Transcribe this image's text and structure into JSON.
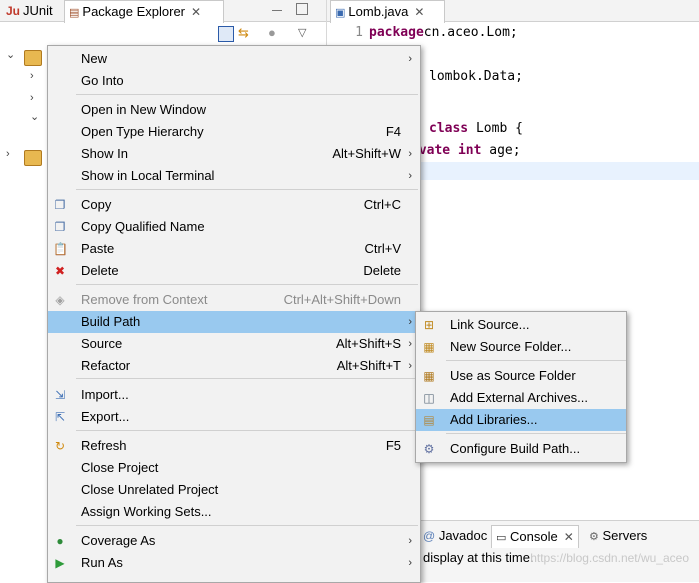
{
  "package_explorer": {
    "tab_junit": "JUnit",
    "tab_label": "Package Explorer"
  },
  "editor": {
    "tab_label": "Lomb.java",
    "lines": [
      {
        "num": "1",
        "parts": [
          [
            "kw",
            "package"
          ],
          [
            "",
            "cn.aceo.Lom;"
          ]
        ]
      },
      {
        "num": "",
        "parts": [
          [
            "",
            ""
          ]
        ]
      },
      {
        "num": "",
        "parts": [
          [
            "",
            "lombok.Data;"
          ]
        ]
      },
      {
        "num": "",
        "parts": [
          [
            "",
            ""
          ]
        ]
      },
      {
        "num": "",
        "parts": [
          [
            "kw",
            "class"
          ],
          [
            "",
            " Lomb {"
          ]
        ]
      },
      {
        "num": "",
        "parts": [
          [
            "kw",
            "ivate"
          ],
          [
            "",
            " "
          ],
          [
            "kw",
            "int"
          ],
          [
            "",
            " age;"
          ]
        ]
      }
    ]
  },
  "bottom_panel": {
    "tab_javadoc": "Javadoc",
    "tab_console": "Console",
    "tab_servers": "Servers",
    "console_text": "display at this time.",
    "watermark": "https://blog.csdn.net/wu_aceo"
  },
  "context_menu": {
    "items": [
      {
        "key": "new",
        "label": "New",
        "accel": "",
        "submenu": true,
        "icon": ""
      },
      {
        "key": "go-into",
        "label": "Go Into",
        "accel": "",
        "submenu": false,
        "icon": ""
      },
      {
        "key": "open-in-new-window",
        "label": "Open in New Window",
        "accel": "",
        "submenu": false,
        "icon": ""
      },
      {
        "key": "open-type-hierarchy",
        "label": "Open Type Hierarchy",
        "accel": "F4",
        "submenu": false,
        "icon": ""
      },
      {
        "key": "show-in",
        "label": "Show In",
        "accel": "Alt+Shift+W",
        "submenu": true,
        "icon": ""
      },
      {
        "key": "show-in-local-terminal",
        "label": "Show in Local Terminal",
        "accel": "",
        "submenu": true,
        "icon": ""
      },
      {
        "key": "copy",
        "label": "Copy",
        "accel": "Ctrl+C",
        "submenu": false,
        "icon": "copy-icon"
      },
      {
        "key": "copy-qualified-name",
        "label": "Copy Qualified Name",
        "accel": "",
        "submenu": false,
        "icon": "copy-icon"
      },
      {
        "key": "paste",
        "label": "Paste",
        "accel": "Ctrl+V",
        "submenu": false,
        "icon": "paste-icon"
      },
      {
        "key": "delete",
        "label": "Delete",
        "accel": "Delete",
        "submenu": false,
        "icon": "delete-icon"
      },
      {
        "key": "remove-from-context",
        "label": "Remove from Context",
        "accel": "Ctrl+Alt+Shift+Down",
        "submenu": false,
        "icon": "remove-context-icon",
        "disabled": true
      },
      {
        "key": "build-path",
        "label": "Build Path",
        "accel": "",
        "submenu": true,
        "icon": "",
        "highlighted": true
      },
      {
        "key": "source",
        "label": "Source",
        "accel": "Alt+Shift+S",
        "submenu": true,
        "icon": ""
      },
      {
        "key": "refactor",
        "label": "Refactor",
        "accel": "Alt+Shift+T",
        "submenu": true,
        "icon": ""
      },
      {
        "key": "import",
        "label": "Import...",
        "accel": "",
        "submenu": false,
        "icon": "import-icon"
      },
      {
        "key": "export",
        "label": "Export...",
        "accel": "",
        "submenu": false,
        "icon": "export-icon"
      },
      {
        "key": "refresh",
        "label": "Refresh",
        "accel": "F5",
        "submenu": false,
        "icon": "refresh-icon"
      },
      {
        "key": "close-project",
        "label": "Close Project",
        "accel": "",
        "submenu": false,
        "icon": ""
      },
      {
        "key": "close-unrelated-project",
        "label": "Close Unrelated Project",
        "accel": "",
        "submenu": false,
        "icon": ""
      },
      {
        "key": "assign-working-sets",
        "label": "Assign Working Sets...",
        "accel": "",
        "submenu": false,
        "icon": ""
      },
      {
        "key": "coverage-as",
        "label": "Coverage As",
        "accel": "",
        "submenu": true,
        "icon": "coverage-icon"
      },
      {
        "key": "run-as",
        "label": "Run As",
        "accel": "",
        "submenu": true,
        "icon": "run-icon"
      }
    ]
  },
  "build_path_submenu": {
    "items": [
      {
        "key": "link-source",
        "label": "Link Source...",
        "icon": "link-source-icon"
      },
      {
        "key": "new-source-folder",
        "label": "New Source Folder...",
        "icon": "source-folder-icon"
      },
      {
        "key": "use-as-source-folder",
        "label": "Use as Source Folder",
        "icon": "use-source-icon"
      },
      {
        "key": "add-external-archives",
        "label": "Add External Archives...",
        "icon": "archive-icon"
      },
      {
        "key": "add-libraries",
        "label": "Add Libraries...",
        "icon": "library-icon",
        "highlighted": true
      },
      {
        "key": "configure-build-path",
        "label": "Configure Build Path...",
        "icon": "config-icon"
      }
    ]
  },
  "colors": {
    "highlight": "#99c9ef",
    "menu_bg": "#f2f2f2",
    "keyword": "#7f0055"
  }
}
